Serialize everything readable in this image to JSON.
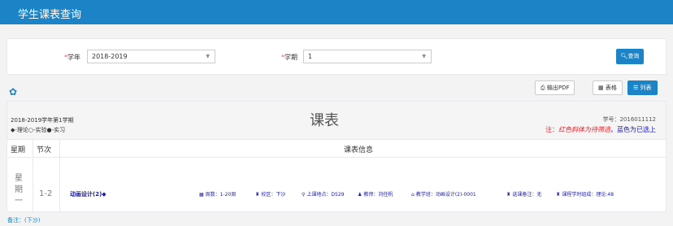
{
  "header": {
    "title": "学生课表查询"
  },
  "filter": {
    "year_label": "学年",
    "year_value": "2018-2019",
    "term_label": "学期",
    "term_value": "1",
    "query_label": "查询"
  },
  "toolbar": {
    "pdf_label": "输出PDF",
    "table_label": "表格",
    "list_label": "列表"
  },
  "schedule": {
    "term_text": "2018-2019学年第1学期",
    "legend_text": "◆-理论○-实验●-实习",
    "title": "课表",
    "student_no": "学号：2016011112",
    "note_prefix": "注：",
    "note_red": "红色斜体为待筛选",
    "note_blue": "，蓝色为已选上",
    "columns": {
      "day": "星期",
      "period": "节次",
      "info": "课表信息"
    },
    "rows": [
      {
        "day": "星期一",
        "period": "1-2",
        "course": "动画设计(2)◆",
        "weeks": "周数：1-20周",
        "campus": "校区：下沙",
        "location": "上课地点：D529",
        "teacher": "教师：刘任帆",
        "class": "教学班：动画设计(2)-0001",
        "remark": "选课备注：无",
        "hours": "课程学时组成：理论:48"
      }
    ]
  },
  "footer": {
    "note": "备注：(下沙)"
  }
}
